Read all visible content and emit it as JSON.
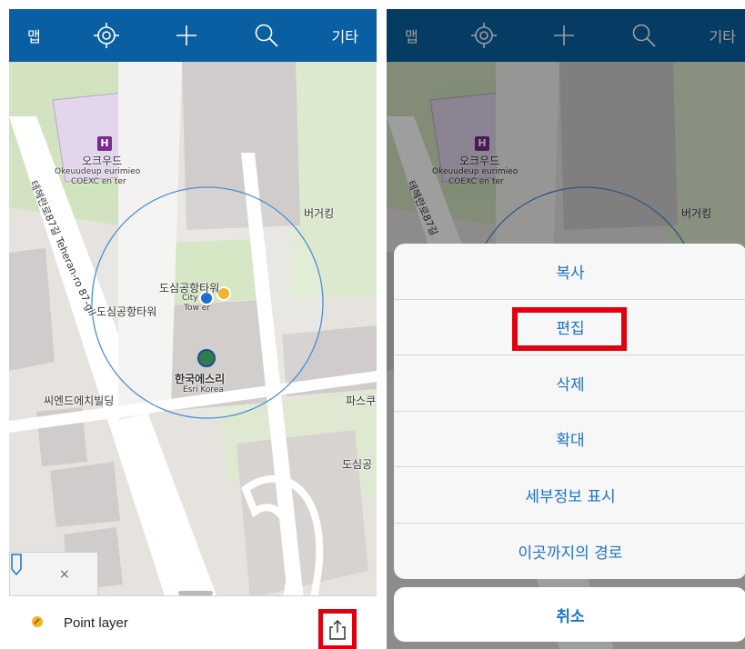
{
  "left_screen": {
    "topbar": {
      "map_label": "맵",
      "more_label": "기타",
      "icons": [
        "locate-icon",
        "add-icon",
        "search-icon"
      ]
    },
    "map_labels": {
      "hotel_ko": "오크우드",
      "hotel_en1": "Okeuudeup eurimieo",
      "hotel_en2": "COEXC en ter",
      "road": "테헤란로87길 Teheran-ro 87-gil",
      "burger": "버거킹",
      "tower_ko": "도심공항타워",
      "tower_ko2": "도심공항타워",
      "city": "City",
      "tower": "Tow er",
      "esri_ko": "한국에스리",
      "esri_en": "Esri Korea",
      "building": "씨엔드에치빌딩",
      "pascucci": "파스쿠",
      "doshim": "도심공"
    },
    "tab_chip": {
      "close": "×"
    },
    "bottom_panel": {
      "layer_name": "Point layer"
    }
  },
  "right_screen": {
    "topbar": {
      "map_label": "맵",
      "more_label": "기타"
    },
    "map_labels": {
      "hotel_ko": "오크우드",
      "hotel_en1": "Okeuudeup eurimieo",
      "hotel_en2": "COEXC en ter",
      "road": "테헤란로87길",
      "burger": "버거킹"
    },
    "action_sheet": {
      "items": [
        "복사",
        "편집",
        "삭제",
        "확대",
        "세부정보 표시",
        "이곳까지의 경로"
      ],
      "cancel": "취소",
      "highlighted_item": "편집"
    }
  },
  "colors": {
    "topbar": "#0a5fa2",
    "accent_blue": "#1a73c7",
    "highlight_red": "#e0000f"
  }
}
